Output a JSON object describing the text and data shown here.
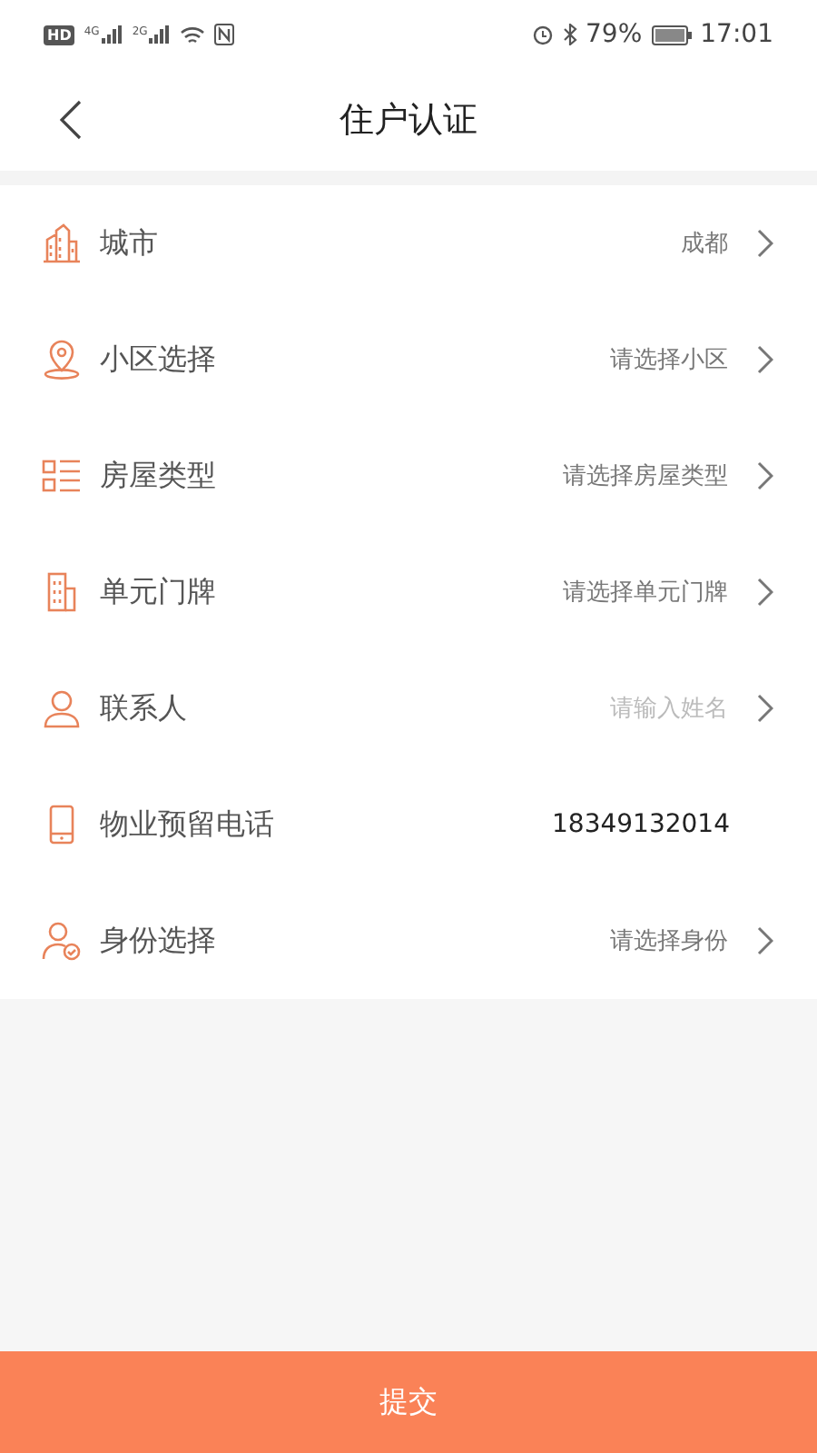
{
  "status_bar": {
    "hd": "HD",
    "networks": [
      "4G",
      "2G"
    ],
    "battery": "79%",
    "time": "17:01"
  },
  "header": {
    "title": "住户认证"
  },
  "rows": [
    {
      "kind": "select",
      "label": "城市",
      "value": "成都"
    },
    {
      "kind": "select",
      "label": "小区选择",
      "value": "请选择小区"
    },
    {
      "kind": "select",
      "label": "房屋类型",
      "value": "请选择房屋类型"
    },
    {
      "kind": "select",
      "label": "单元门牌",
      "value": "请选择单元门牌"
    },
    {
      "kind": "input",
      "label": "联系人",
      "placeholder": "请输入姓名"
    },
    {
      "kind": "text",
      "label": "物业预留电话",
      "value": "18349132014"
    },
    {
      "kind": "select",
      "label": "身份选择",
      "value": "请选择身份"
    }
  ],
  "submit": {
    "label": "提交"
  }
}
